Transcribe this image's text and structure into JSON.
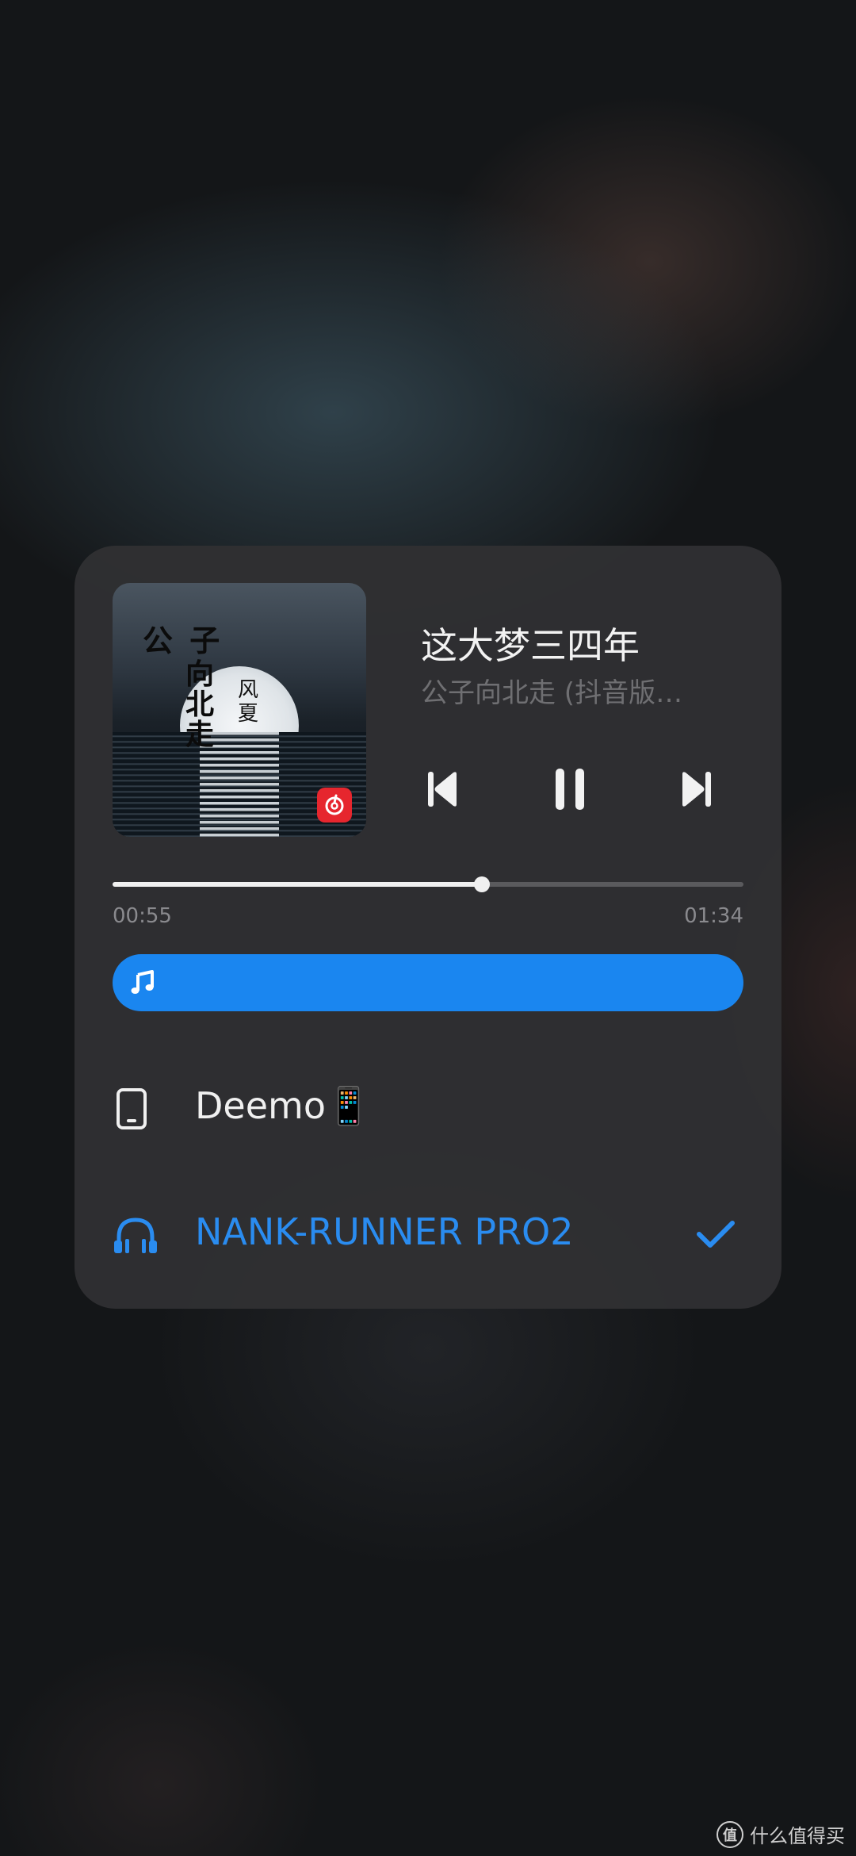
{
  "player": {
    "song_title": "这大梦三四年",
    "artist_album": "公子向北走 (抖音版…",
    "album_art": {
      "title_text": "公 子",
      "subtitle_text": "向北走",
      "side_text": "风 夏",
      "app_badge_icon": "netease-music-icon"
    },
    "controls": {
      "previous_icon": "skip-previous-icon",
      "pause_icon": "pause-icon",
      "next_icon": "skip-next-icon"
    },
    "progress": {
      "elapsed": "00:55",
      "total": "01:34",
      "fraction": 0.585
    },
    "volume": {
      "icon": "music-note-icon",
      "fraction": 1.0,
      "color": "#1a86f0"
    }
  },
  "output_devices": [
    {
      "name": "Deemo📱",
      "icon": "tablet-icon",
      "selected": false,
      "color": "#f0f0f0"
    },
    {
      "name": "NANK-RUNNER PRO2",
      "icon": "headphones-icon",
      "selected": true,
      "color": "#2a8cf0"
    }
  ],
  "watermark": {
    "text": "什么值得买",
    "logo_text": "值"
  }
}
